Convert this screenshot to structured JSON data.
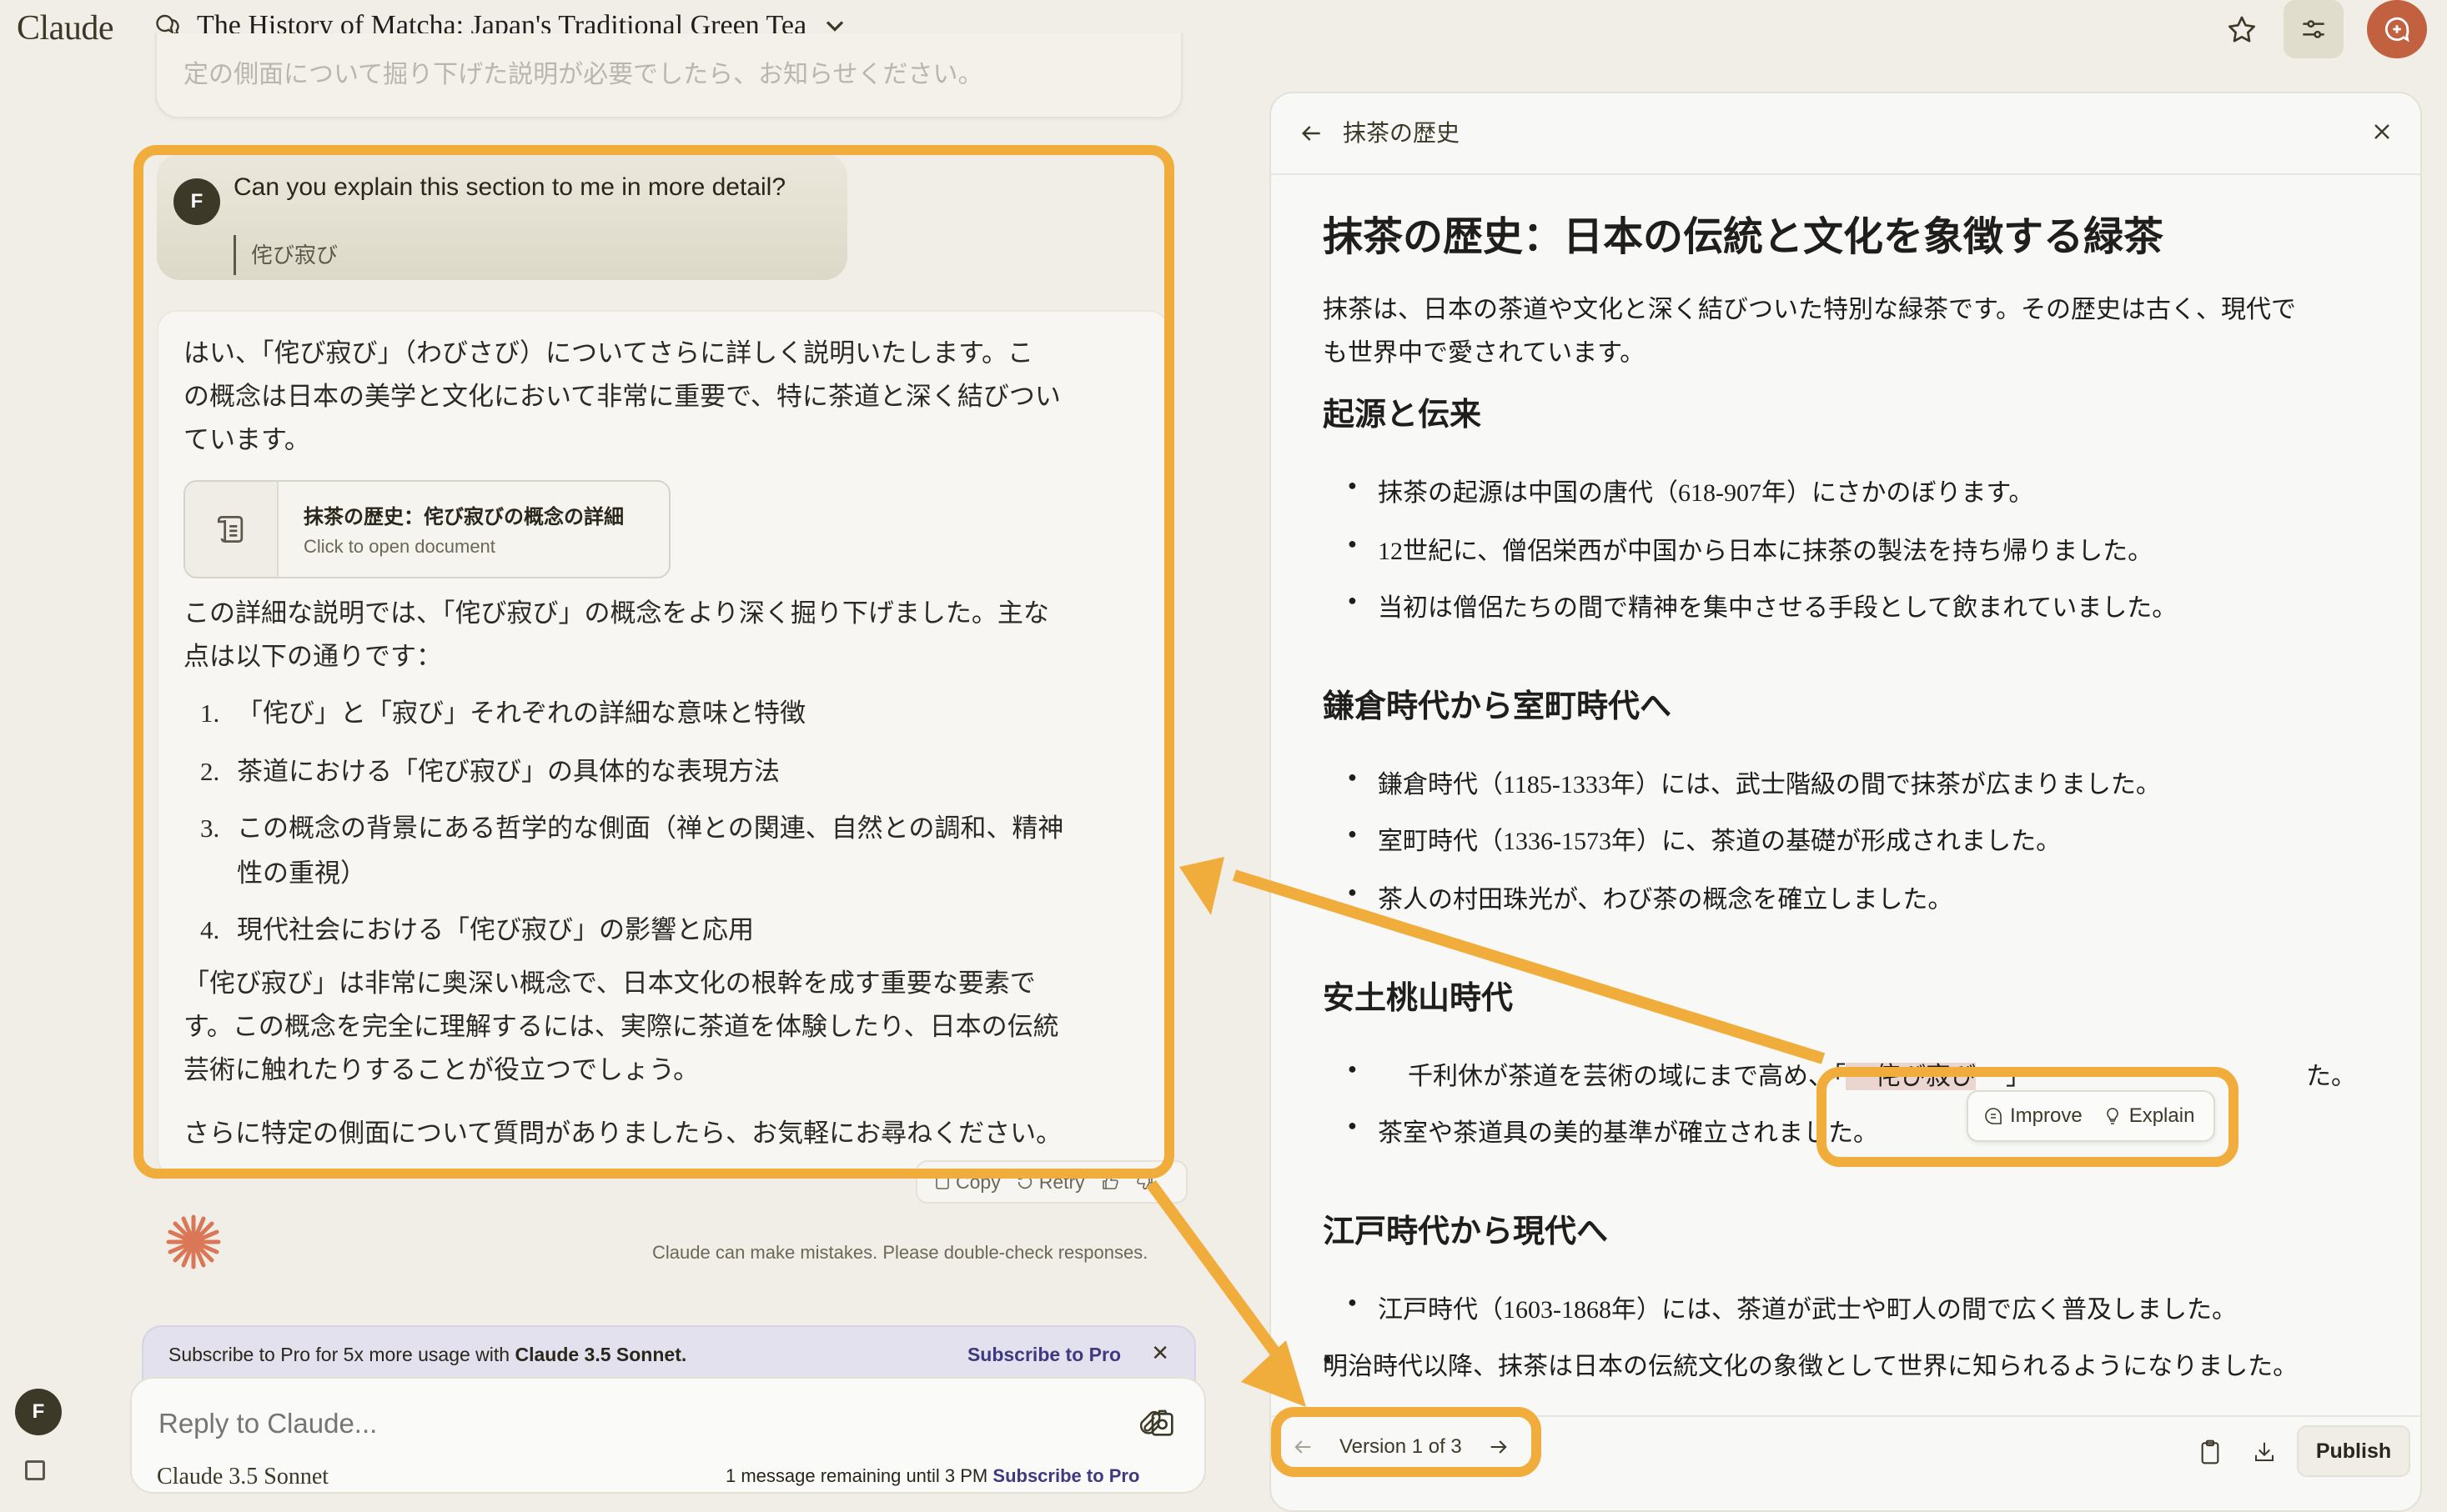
{
  "header": {
    "logo": "Claude",
    "conversation_title": "The History of Matcha: Japan's Traditional Green Tea",
    "icons": [
      "chat-bubbles-icon",
      "chevron-down-icon",
      "star-icon",
      "sliders-icon",
      "new-chat-icon"
    ]
  },
  "chat": {
    "previous_message_tail": "定の側面について掘り下げた説明が必要でしたら、お知らせください。",
    "user_message": {
      "avatar": "F",
      "text": "Can you explain this section to me in more detail?",
      "quote": "侘び寂び"
    },
    "assistant_message": {
      "intro_lines": [
        "はい、「侘び寂び」（わびさび）についてさらに詳しく説明いたします。こ",
        "の概念は日本の美学と文化において非常に重要で、特に茶道と深く結びつい",
        "ています。"
      ],
      "document_card": {
        "title": "抹茶の歴史：侘び寂びの概念の詳細",
        "subtitle": "Click to open document"
      },
      "summary_lines": [
        "この詳細な説明では、「侘び寂び」の概念をより深く掘り下げました。主な",
        "点は以下の通りです："
      ],
      "list": [
        {
          "n": "1.",
          "text": "「侘び」と「寂び」それぞれの詳細な意味と特徴"
        },
        {
          "n": "2.",
          "text": "茶道における「侘び寂び」の具体的な表現方法"
        },
        {
          "n": "3.",
          "text": "この概念の背景にある哲学的な側面（禅との関連、自然との調和、精神",
          "cont": "性の重視）"
        },
        {
          "n": "4.",
          "text": "現代社会における「侘び寂び」の影響と応用"
        }
      ],
      "closing_lines": [
        "「侘び寂び」は非常に奥深い概念で、日本文化の根幹を成す重要な要素で",
        "す。この概念を完全に理解するには、実際に茶道を体験したり、日本の伝統",
        "芸術に触れたりすることが役立つでしょう。"
      ],
      "final_line": "さらに特定の側面について質問がありましたら、お気軽にお尋ねください。"
    },
    "actions": {
      "copy": "Copy",
      "retry": "Retry"
    },
    "disclaimer": "Claude can make mistakes. Please double-check responses."
  },
  "promo": {
    "text_prefix": "Subscribe to Pro for 5x more usage with ",
    "text_bold": "Claude 3.5 Sonnet.",
    "link": "Subscribe to Pro"
  },
  "composer": {
    "placeholder": "Reply to Claude...",
    "model": "Claude 3.5 Sonnet",
    "remaining": "1 message remaining until 3 PM",
    "remaining_link": "Subscribe to Pro"
  },
  "sidebar": {
    "avatar": "F"
  },
  "artifact": {
    "header_title": "抹茶の歴史",
    "title": "抹茶の歴史：日本の伝統と文化を象徴する緑茶",
    "intro_lines": [
      "抹茶は、日本の茶道や文化と深く結びついた特別な緑茶です。その歴史は古く、現代で",
      "も世界中で愛されています。"
    ],
    "sections": [
      {
        "heading": "起源と伝来",
        "items": [
          "抹茶の起源は中国の唐代（618-907年）にさかのぼります。",
          "12世紀に、僧侶栄西が中国から日本に抹茶の製法を持ち帰りました。",
          "当初は僧侶たちの間で精神を集中させる手段として飲まれていました。"
        ]
      },
      {
        "heading": "鎌倉時代から室町時代へ",
        "items": [
          "鎌倉時代（1185-1333年）には、武士階級の間で抹茶が広まりました。",
          "室町時代（1336-1573年）に、茶道の基礎が形成されました。",
          "茶人の村田珠光が、わび茶の概念を確立しました。"
        ]
      },
      {
        "heading": "安土桃山時代",
        "items": [
          {
            "before": "千利休が茶道を芸術の域にまで高め、「",
            "highlight": "侘び寂び",
            "after": "」",
            "tail": "た。"
          },
          "茶室や茶道具の美的基準が確立されました。"
        ]
      },
      {
        "heading": "江戸時代から現代へ",
        "items": [
          "江戸時代（1603-1868年）には、茶道が武士や町人の間で広く普及しました。",
          "明治時代以降、抹茶は日本の伝統文化の象徴として世界に知られるようになりました。"
        ]
      }
    ],
    "selection_popup": {
      "improve": "Improve",
      "explain": "Explain"
    },
    "footer": {
      "version": "Version 1 of 3",
      "publish": "Publish"
    }
  },
  "annotation_color": "#f0ad3c",
  "accent_color": "#c2613f",
  "link_color": "#3f3a80"
}
